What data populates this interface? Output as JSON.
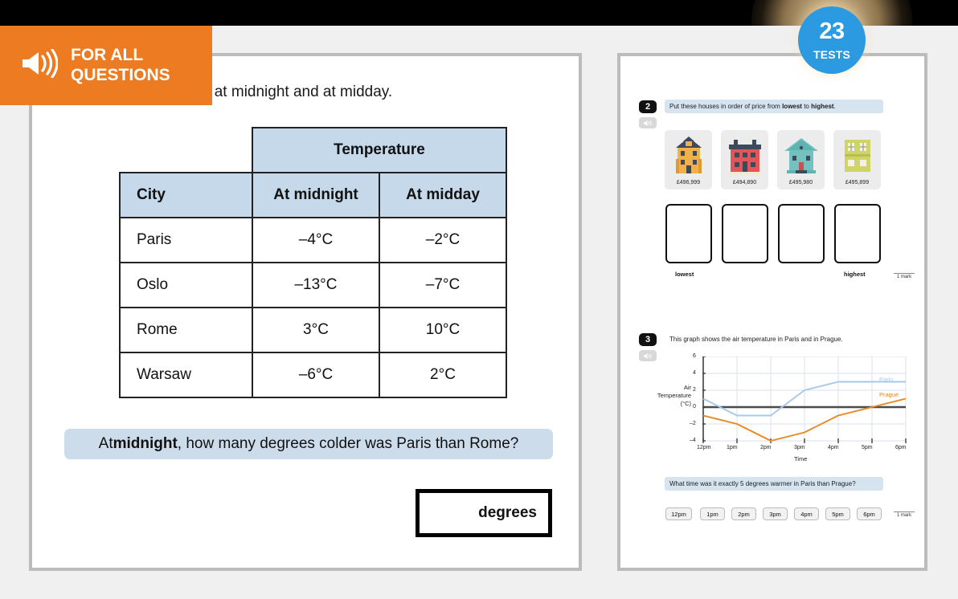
{
  "topbar": {
    "badge_number": "23",
    "badge_label": "TESTS",
    "badge_color": "#2b9ae0"
  },
  "banner": {
    "line1": "FOR ALL",
    "line2": "QUESTIONS",
    "color": "#ed7b22",
    "icon": "speaker-icon"
  },
  "left_question": {
    "intro_visible_text": "atures in four cities at midnight and at midday.",
    "table": {
      "group_header": "Temperature",
      "columns": [
        "City",
        "At midnight",
        "At midday"
      ],
      "rows": [
        {
          "city": "Paris",
          "midnight": "–4°C",
          "midday": "–2°C"
        },
        {
          "city": "Oslo",
          "midnight": "–13°C",
          "midday": "–7°C"
        },
        {
          "city": "Rome",
          "midnight": "3°C",
          "midday": "10°C"
        },
        {
          "city": "Warsaw",
          "midnight": "–6°C",
          "midday": "2°C"
        }
      ]
    },
    "prompt_prefix": "At ",
    "prompt_bold": "midnight",
    "prompt_suffix": ", how many degrees colder was Paris than Rome?",
    "answer_unit": "degrees",
    "answer_value": ""
  },
  "right_page": {
    "q2": {
      "number": "2",
      "text_prefix": "Put these houses in order of price from ",
      "text_bold1": "lowest",
      "text_middle": " to ",
      "text_bold2": "highest",
      "text_suffix": ".",
      "houses": [
        {
          "price": "£496,999",
          "color": "#f0b04a",
          "roof": "#3d4a5c"
        },
        {
          "price": "£494,890",
          "color": "#e2565a",
          "roof": "#3d4a5c"
        },
        {
          "price": "£495,980",
          "color": "#73c2bf",
          "roof": "#3d4a5c"
        },
        {
          "price": "£495,899",
          "color": "#cfd368",
          "roof": "#b9bd55"
        }
      ],
      "drop_labels": {
        "left": "lowest",
        "right": "highest"
      },
      "mark": "1 mark"
    },
    "q3": {
      "number": "3",
      "text": "This graph shows the air temperature in Paris and in Prague.",
      "question": "What time was it exactly 5 degrees warmer in Paris than Prague?",
      "options": [
        "12pm",
        "1pm",
        "2pm",
        "3pm",
        "4pm",
        "5pm",
        "6pm"
      ],
      "mark": "1 mark"
    }
  },
  "chart_data": {
    "type": "line",
    "title": "",
    "xlabel": "Time",
    "ylabel": "Air Temperature (°C)",
    "ylabel_lines": [
      "Air",
      "Temperature",
      "(°C)"
    ],
    "x": [
      "12pm",
      "1pm",
      "2pm",
      "3pm",
      "4pm",
      "5pm",
      "6pm"
    ],
    "xlim": [
      0,
      6
    ],
    "ylim": [
      -4,
      6
    ],
    "yticks": [
      6,
      4,
      2,
      0,
      -2,
      -4
    ],
    "ytick_labels": [
      "6",
      "4",
      "2",
      "0",
      "–2",
      "–4"
    ],
    "grid": true,
    "zero_line": true,
    "legend_position": "inline-right",
    "series": [
      {
        "name": "Paris",
        "color": "#a8c8e8",
        "values": [
          1,
          -1,
          -1,
          2,
          3,
          3,
          3
        ]
      },
      {
        "name": "Prague",
        "color": "#e8881f",
        "values": [
          -1,
          -2,
          -4,
          -3,
          -1,
          0,
          1
        ]
      }
    ]
  }
}
